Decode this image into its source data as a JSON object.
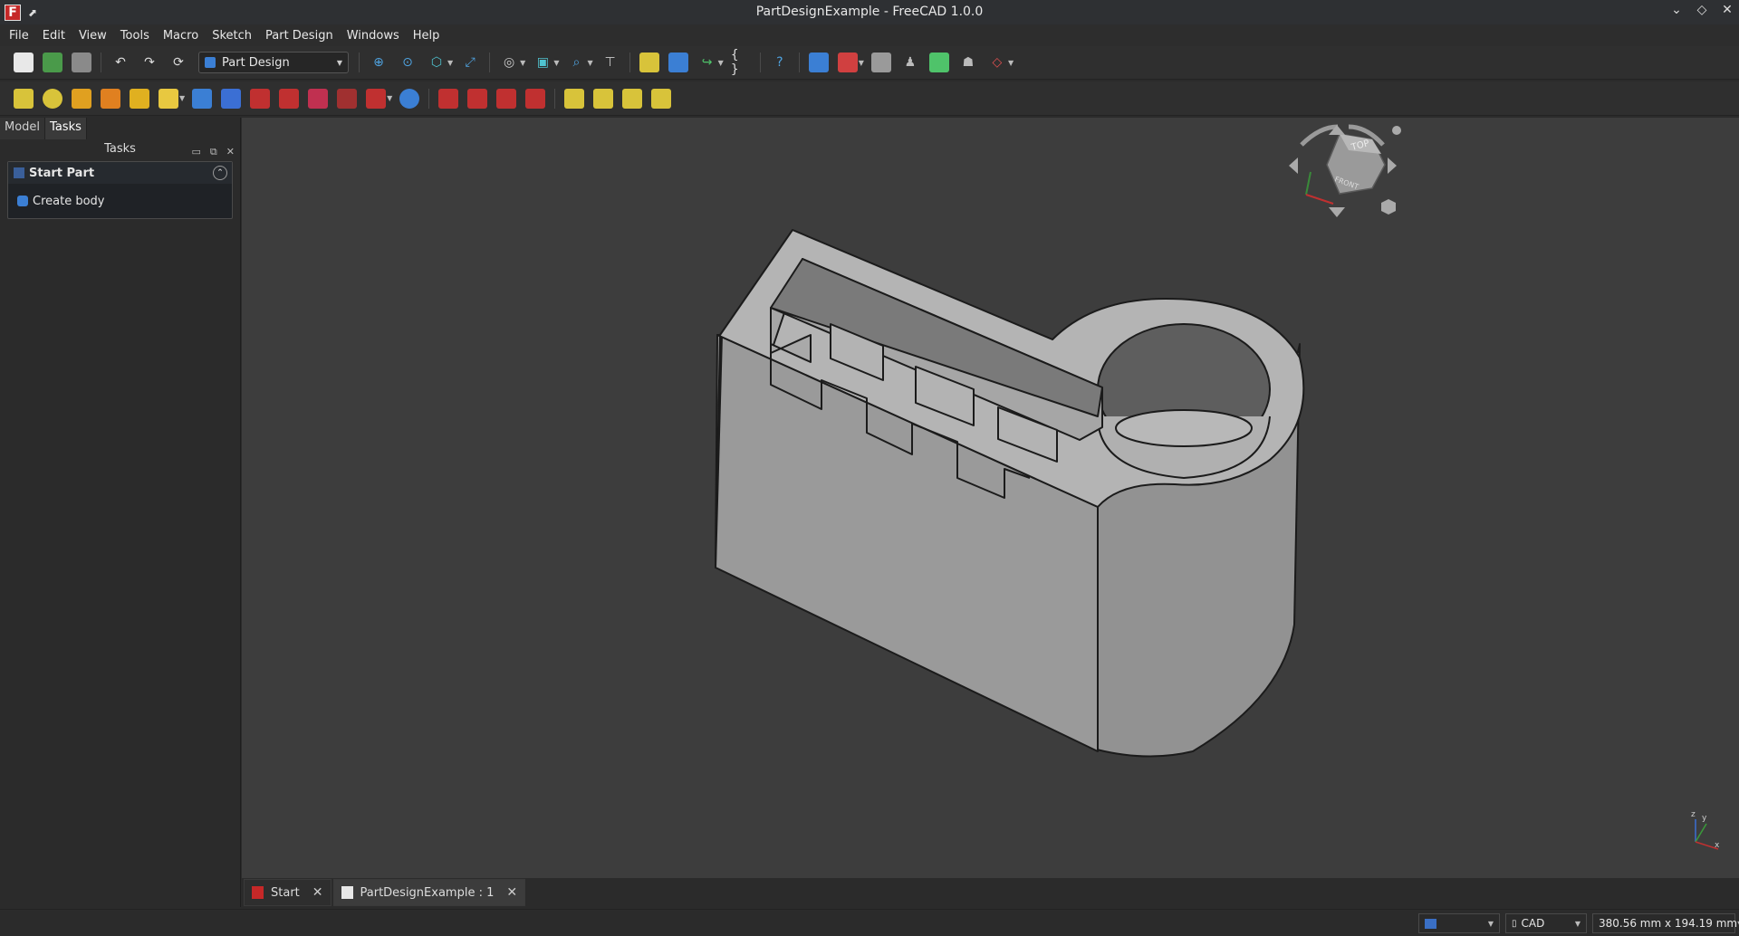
{
  "window": {
    "title": "PartDesignExample - FreeCAD 1.0.0",
    "app_icon": "F",
    "pin": "⬈"
  },
  "window_controls": {
    "minimize": "⌄",
    "maximize": "◇",
    "close": "✕"
  },
  "menu": [
    "File",
    "Edit",
    "View",
    "Tools",
    "Macro",
    "Sketch",
    "Part Design",
    "Windows",
    "Help"
  ],
  "workbench_selector": {
    "value": "Part Design"
  },
  "left_panel": {
    "tabs": [
      "Model",
      "Tasks"
    ],
    "header": "Tasks",
    "task_box": {
      "title": "Start Part",
      "action": "Create body"
    }
  },
  "doc_tabs": [
    {
      "label": "Start"
    },
    {
      "label": "PartDesignExample : 1"
    }
  ],
  "navcube": {
    "top": "TOP",
    "front": "FRONT"
  },
  "axis": {
    "z": "z",
    "y": "y",
    "x": "x"
  },
  "status": {
    "navigation": "CAD",
    "dimensions": "380.56 mm x 194.19 mm"
  },
  "colors": {
    "accent_blue": "#3b7fd4",
    "part_gray": "#9a9a9a",
    "viewport_bg": "#3d3d3d"
  }
}
